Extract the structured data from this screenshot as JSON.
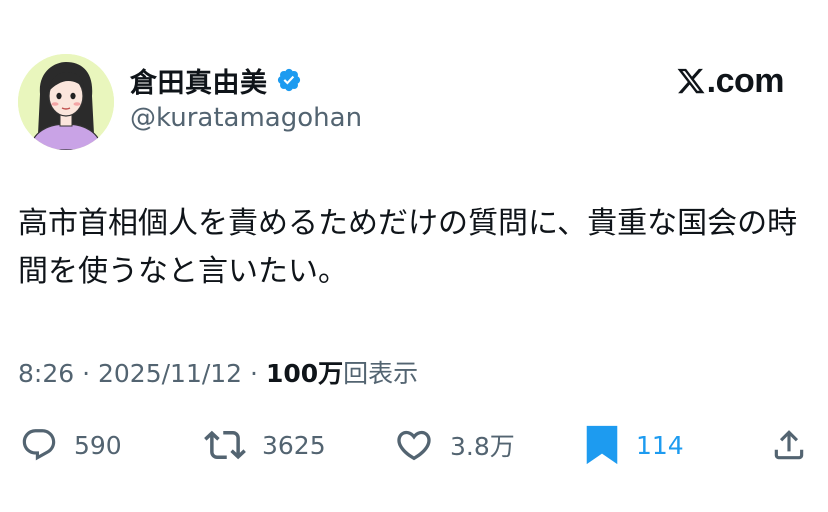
{
  "author": {
    "display_name": "倉田真由美",
    "handle": "@kuratamagohan",
    "verified": true,
    "avatar_icon": "avatar-illustration"
  },
  "brand": {
    "logo_icon": "x-logo-icon",
    "text": ".com"
  },
  "tweet": {
    "text": "高市首相個人を責めるためだけの質問に、貴重な国会の時間を使うなと言いたい。"
  },
  "meta": {
    "time": "8:26",
    "separator": "·",
    "date": "2025/11/12",
    "views_count": "100万",
    "views_label": "回表示"
  },
  "actions": {
    "replies": {
      "icon": "reply-icon",
      "count": "590"
    },
    "reposts": {
      "icon": "repost-icon",
      "count": "3625"
    },
    "likes": {
      "icon": "heart-icon",
      "count": "3.8万"
    },
    "bookmarks": {
      "icon": "bookmark-icon",
      "count": "114"
    },
    "share": {
      "icon": "share-icon"
    }
  },
  "colors": {
    "text": "#0f1419",
    "secondary": "#536471",
    "accent": "#1d9bf0"
  }
}
